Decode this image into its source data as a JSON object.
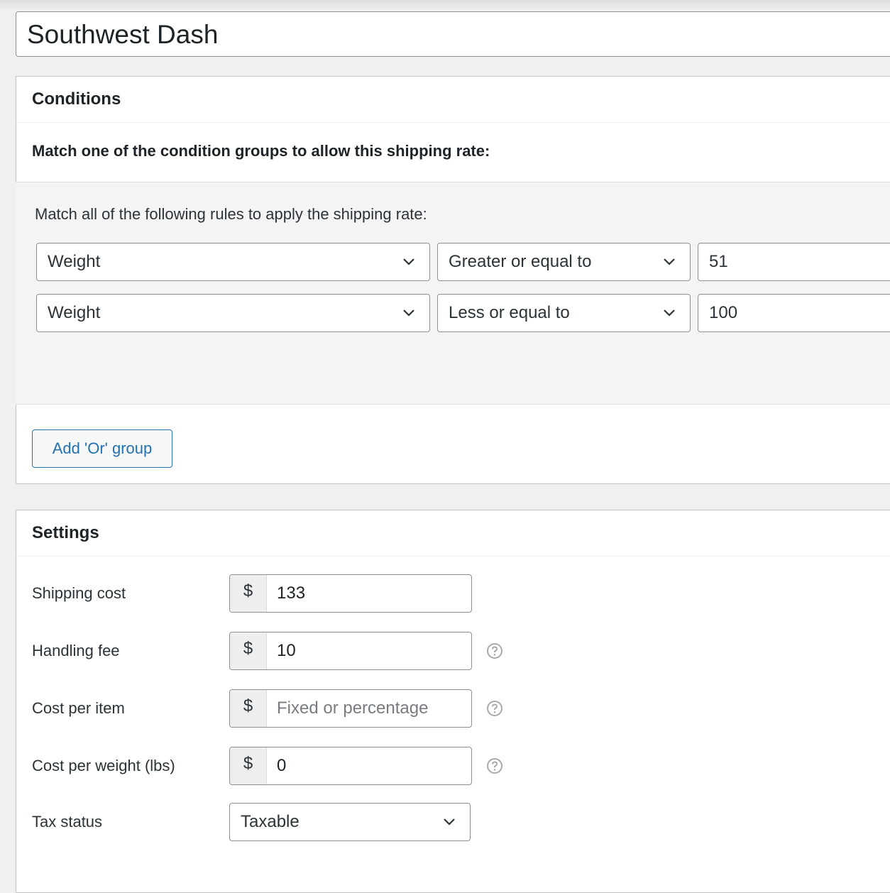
{
  "title_input": {
    "value": "Southwest Dash"
  },
  "conditions": {
    "heading": "Conditions",
    "match_one_text": "Match one of the condition groups to allow this shipping rate:",
    "group": {
      "match_all_text": "Match all of the following rules to apply the shipping rate:",
      "rules": [
        {
          "condition": "Weight",
          "operator": "Greater or equal to",
          "value": "51"
        },
        {
          "condition": "Weight",
          "operator": "Less or equal to",
          "value": "100"
        }
      ]
    },
    "add_or_group_label": "Add 'Or' group"
  },
  "settings": {
    "heading": "Settings",
    "currency_symbol": "$",
    "shipping_cost": {
      "label": "Shipping cost",
      "value": "133"
    },
    "handling_fee": {
      "label": "Handling fee",
      "value": "10"
    },
    "cost_per_item": {
      "label": "Cost per item",
      "value": "",
      "placeholder": "Fixed or percentage"
    },
    "cost_per_weight": {
      "label": "Cost per weight (lbs)",
      "value": "0"
    },
    "tax_status": {
      "label": "Tax status",
      "value": "Taxable"
    }
  },
  "icons": {
    "dropdown": "chevron-down-icon",
    "help": "question-circle-icon"
  },
  "colors": {
    "accent": "#2271b1",
    "background": "#f0f0f1",
    "group_background": "#f4f4f4"
  }
}
